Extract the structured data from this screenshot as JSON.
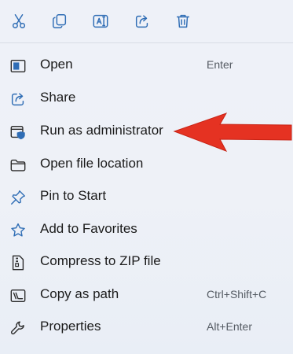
{
  "toolbar": {
    "buttons": [
      {
        "icon": "cut-icon"
      },
      {
        "icon": "copy-icon"
      },
      {
        "icon": "rename-icon"
      },
      {
        "icon": "share-icon"
      },
      {
        "icon": "delete-icon"
      }
    ]
  },
  "menu": {
    "items": [
      {
        "label": "Open",
        "shortcut": "Enter",
        "icon": "app-window-icon"
      },
      {
        "label": "Share",
        "shortcut": "",
        "icon": "share-icon"
      },
      {
        "label": "Run as administrator",
        "shortcut": "",
        "icon": "uac-shield-icon"
      },
      {
        "label": "Open file location",
        "shortcut": "",
        "icon": "folder-icon"
      },
      {
        "label": "Pin to Start",
        "shortcut": "",
        "icon": "pin-icon"
      },
      {
        "label": "Add to Favorites",
        "shortcut": "",
        "icon": "star-icon"
      },
      {
        "label": "Compress to ZIP file",
        "shortcut": "",
        "icon": "zip-icon"
      },
      {
        "label": "Copy as path",
        "shortcut": "Ctrl+Shift+C",
        "icon": "copy-path-icon"
      },
      {
        "label": "Properties",
        "shortcut": "Alt+Enter",
        "icon": "wrench-icon"
      }
    ]
  },
  "annotation": {
    "color": "#e53222"
  },
  "colors": {
    "accent": "#2f6db5",
    "text": "#1b1b1b",
    "shortcut": "#555b63"
  }
}
